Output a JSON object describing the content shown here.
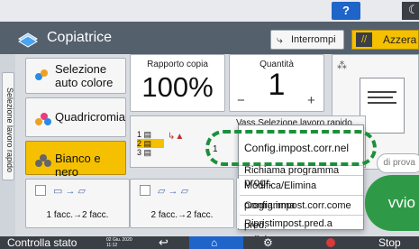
{
  "status": {
    "help_label": "?",
    "night_icon": "moon-icon"
  },
  "header": {
    "title": "Copiatrice",
    "interrupt_label": "Interrompi",
    "reset_label": "Azzera",
    "app_icon": "copier-icon"
  },
  "sidetab": {
    "label": "Selezione lavoro rapido"
  },
  "color_modes": [
    {
      "label": "Selezione\nauto colore",
      "selected": false,
      "icon": "auto-color-icon"
    },
    {
      "label": "Quadricromia",
      "selected": false,
      "icon": "full-color-icon"
    },
    {
      "label": "Bianco e nero",
      "selected": true,
      "icon": "black-white-icon"
    }
  ],
  "ratio": {
    "caption": "Rapporto copia",
    "value": "100%"
  },
  "quantity": {
    "caption": "Quantità",
    "value": "1",
    "minus": "−",
    "plus": "+"
  },
  "paper": {
    "trays": [
      "1",
      "2",
      "3"
    ],
    "section_label": "Vass",
    "menu_header": "Selezione lavoro rapido"
  },
  "dropdown": {
    "items": [
      "Config.impost.corr.nel progr.",
      "Richiama programma",
      "Modifica/Elimina programma",
      "Config.impost.corr.come pred.",
      "Ripristimpost.pred.a valiniz."
    ]
  },
  "preview": {
    "proof_label": "di prova"
  },
  "start": {
    "label": "vvio"
  },
  "duplex": [
    {
      "label": "1 facc.→2 facc."
    },
    {
      "label": "2 facc.→2 facc."
    }
  ],
  "footer": {
    "status_label": "Controlla stato",
    "date": "02 Giu. 2020",
    "time": "11:12",
    "stop_label": "Stop"
  },
  "colors": {
    "accent_yellow": "#f4c000",
    "start_green": "#2e9a47",
    "highlight_green": "#1c8f3a",
    "title_bar": "#55606d"
  }
}
